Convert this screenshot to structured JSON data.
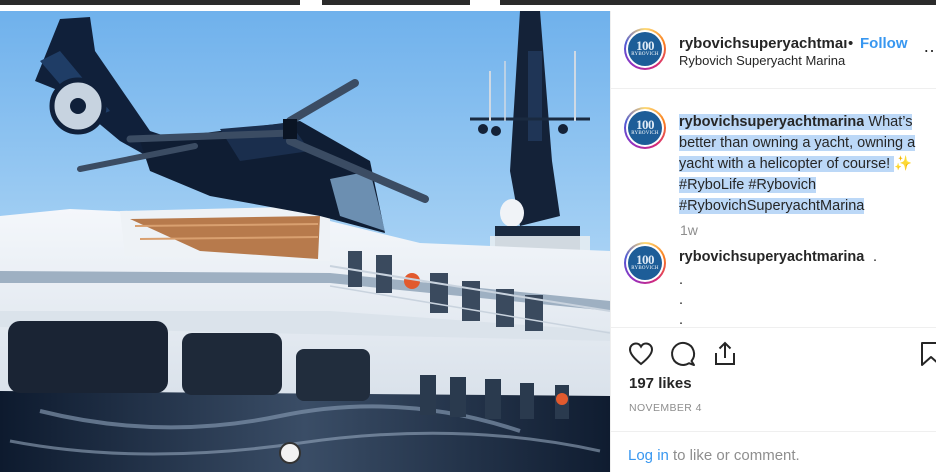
{
  "post": {
    "username": "rybovichsuperyachtmarina",
    "header_username": "rybovichsuperyachtmaı",
    "separator": "•",
    "follow_label": "Follow",
    "location": "Rybovich Superyacht Marina",
    "avatar": {
      "number": "100",
      "brand": "RYBOVICH"
    }
  },
  "caption": {
    "username": "rybovichsuperyachtmarina",
    "text": " What’s better than owning a yacht, owning a yacht with a helicopter of course! ",
    "sparkle": "✨",
    "hashtags": "#RyboLife #Rybovich #RybovichSuperyachtMarina",
    "time": "1w"
  },
  "comment": {
    "username": "rybovichsuperyachtmarina",
    "text": ".",
    "lines": [
      ".",
      ".",
      "."
    ]
  },
  "actions": {
    "icons": [
      "heart-icon",
      "comment-icon",
      "share-icon",
      "bookmark-icon"
    ]
  },
  "likes": "197 likes",
  "date": "NOVEMBER 4",
  "footer": {
    "login_link": "Log in",
    "rest": "to like or comment."
  },
  "colors": {
    "link": "#3897f0",
    "text": "#262626",
    "muted": "#8e8e8e",
    "selection": "#bcd8f7",
    "brand_blue": "#1d5d98"
  }
}
